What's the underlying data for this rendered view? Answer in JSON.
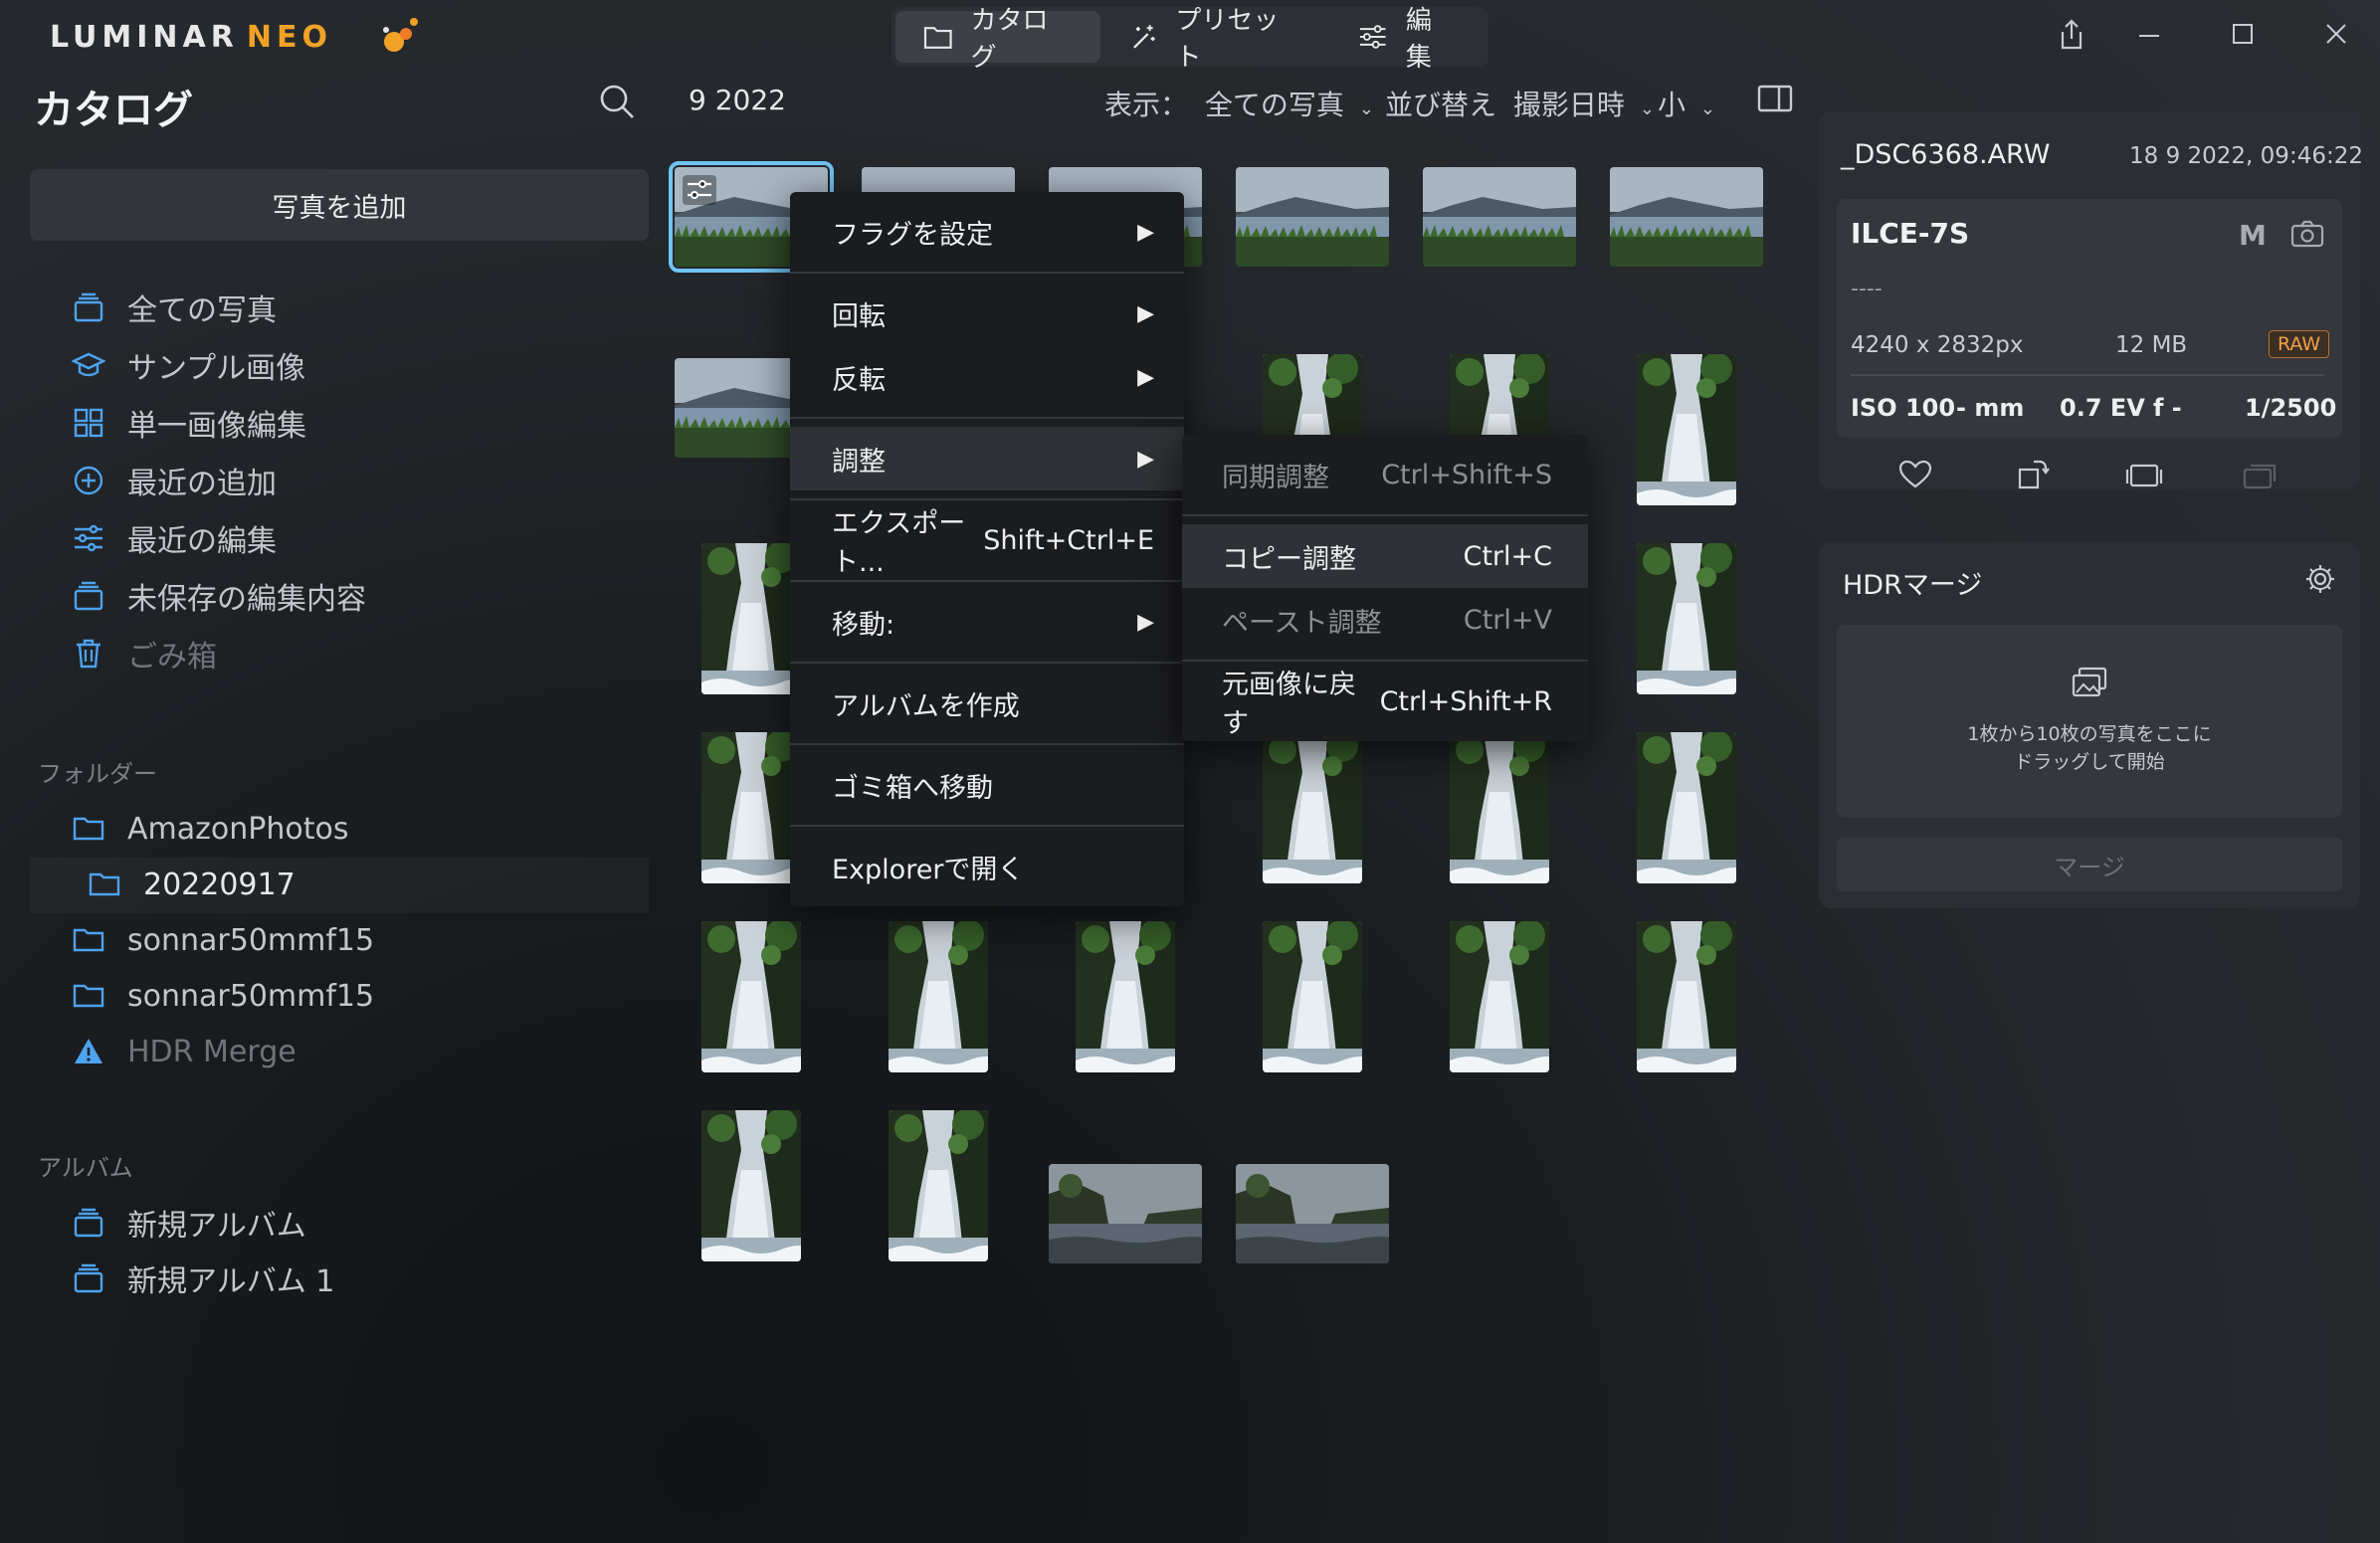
{
  "app": {
    "logo_text": "LUMINAR",
    "logo_suffix": "NEO",
    "tabs": [
      {
        "label": "カタログ",
        "icon": "folder-icon"
      },
      {
        "label": "プリセット",
        "icon": "magic-wand-icon"
      },
      {
        "label": "編集",
        "icon": "sliders-icon"
      }
    ]
  },
  "sidebar": {
    "title": "カタログ",
    "add_button": "写真を追加",
    "nav": [
      {
        "label": "全ての写真",
        "icon": "photos-stack-icon"
      },
      {
        "label": "サンプル画像",
        "icon": "graduation-cap-icon"
      },
      {
        "label": "単一画像編集",
        "icon": "grid-icon"
      },
      {
        "label": "最近の追加",
        "icon": "plus-circle-icon"
      },
      {
        "label": "最近の編集",
        "icon": "sliders-icon"
      },
      {
        "label": "未保存の編集内容",
        "icon": "photos-stack-icon"
      },
      {
        "label": "ごみ箱",
        "icon": "trash-icon"
      }
    ],
    "folders_title": "フォルダー",
    "folders": [
      {
        "label": "AmazonPhotos",
        "icon": "folder-icon"
      },
      {
        "label": "20220917",
        "icon": "folder-icon"
      },
      {
        "label": "sonnar50mmf15",
        "icon": "folder-icon"
      },
      {
        "label": "sonnar50mmf15",
        "icon": "folder-icon"
      },
      {
        "label": "HDR Merge",
        "icon": "warning-icon"
      }
    ],
    "albums_title": "アルバム",
    "albums": [
      {
        "label": "新規アルバム",
        "icon": "album-icon"
      },
      {
        "label": "新規アルバム 1",
        "icon": "album-icon"
      }
    ]
  },
  "grid": {
    "date": "9 2022",
    "view_label": "表示：",
    "view_value": "全ての写真",
    "sort_label": "並び替え",
    "sort_value": "撮影日時",
    "size_value": "小"
  },
  "context_menu": {
    "items": [
      {
        "label": "フラグを設定",
        "shortcut": "",
        "submenu": true
      },
      {
        "label": "回転",
        "shortcut": "",
        "submenu": true
      },
      {
        "label": "反転",
        "shortcut": "",
        "submenu": true
      },
      {
        "label": "調整",
        "shortcut": "",
        "submenu": true
      },
      {
        "label": "エクスポート...",
        "shortcut": "Shift+Ctrl+E",
        "submenu": false
      },
      {
        "label": "移動:",
        "shortcut": "",
        "submenu": true
      },
      {
        "label": "アルバムを作成",
        "shortcut": "",
        "submenu": false
      },
      {
        "label": "ゴミ箱へ移動",
        "shortcut": "",
        "submenu": false
      },
      {
        "label": "Explorerで開く",
        "shortcut": "",
        "submenu": false
      }
    ],
    "arrow": "▶"
  },
  "adjust_submenu": {
    "items": [
      {
        "label": "同期調整",
        "shortcut": "Ctrl+Shift+S"
      },
      {
        "label": "コピー調整",
        "shortcut": "Ctrl+C"
      },
      {
        "label": "ペースト調整",
        "shortcut": "Ctrl+V"
      },
      {
        "label": "元画像に戻す",
        "shortcut": "Ctrl+Shift+R"
      }
    ]
  },
  "info": {
    "filename": "_DSC6368.ARW",
    "datetime": "18 9 2022, 09:46:22",
    "camera": "ILCE-7S",
    "mode": "M",
    "lens": "----",
    "dimensions": "4240 x 2832px",
    "filesize": "12 MB",
    "format_badge": "RAW",
    "iso": "ISO 100",
    "focal": "- mm",
    "ev": "0.7 EV",
    "aperture": "f -",
    "shutter": "1/2500"
  },
  "hdr": {
    "title": "HDRマージ",
    "drop_text_1": "1枚から10枚の写真をここに",
    "drop_text_2": "ドラッグして開始",
    "merge_button": "マージ"
  },
  "colors": {
    "accent": "#6fc3f0",
    "brand_orange": "#f0a226",
    "raw_badge": "#f0a04b",
    "icon_blue": "#4da3f0"
  }
}
